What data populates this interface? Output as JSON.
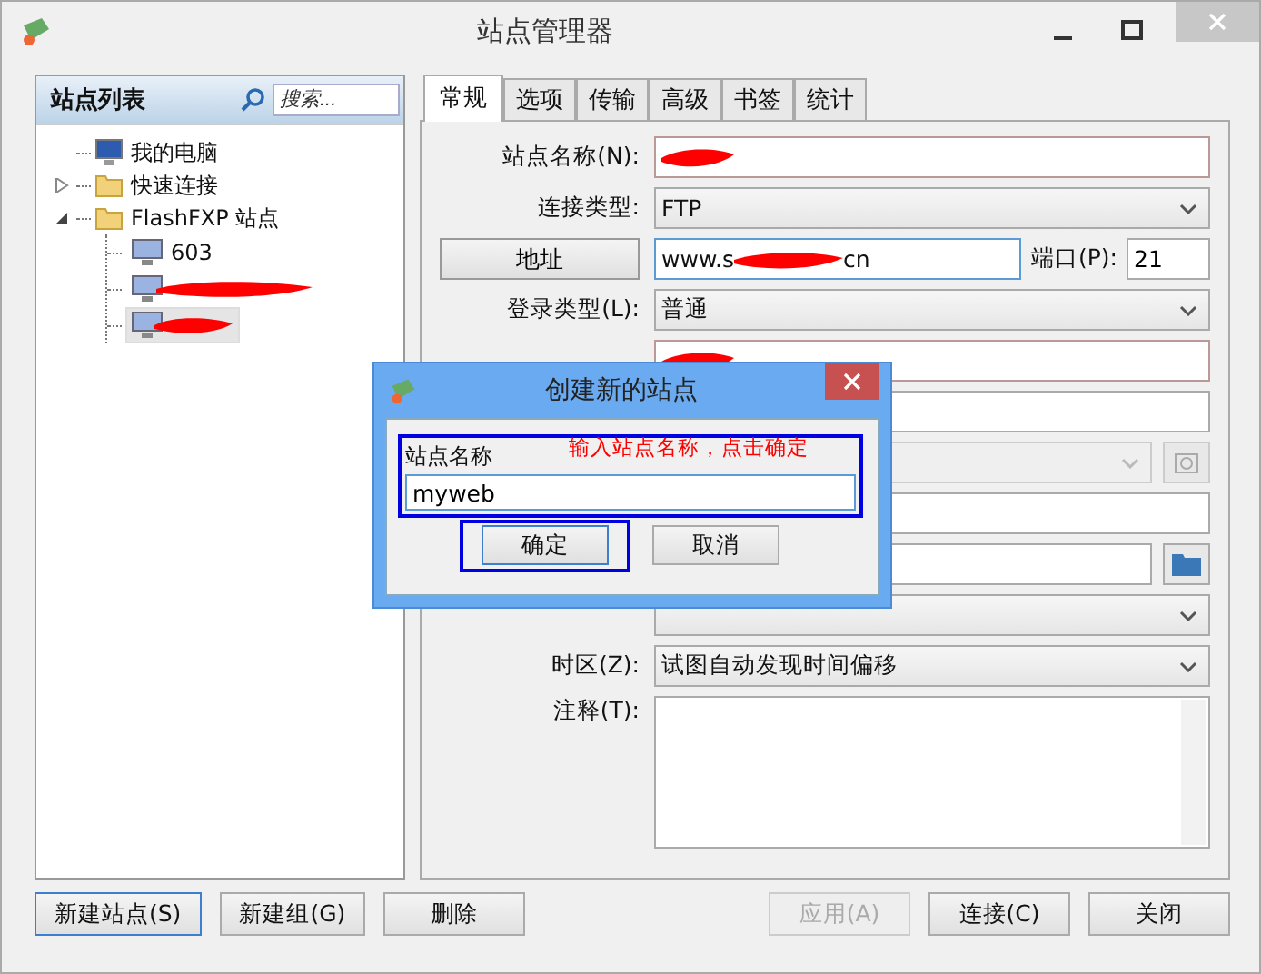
{
  "window": {
    "title": "站点管理器"
  },
  "site_list": {
    "title": "站点列表",
    "search_placeholder": "搜索...",
    "tree": [
      {
        "label": "我的电脑",
        "kind": "computer",
        "selected": false
      },
      {
        "label": "快速连接",
        "kind": "folder",
        "expanded": false,
        "selected": false
      },
      {
        "label": "FlashFXP 站点",
        "kind": "folder",
        "expanded": true,
        "selected": false,
        "children": [
          {
            "label": "603",
            "kind": "computer",
            "redacted": false,
            "selected": false
          },
          {
            "kind": "computer",
            "redacted": true,
            "selected": false
          },
          {
            "kind": "computer",
            "redacted": true,
            "selected": true
          }
        ]
      }
    ]
  },
  "tabs": [
    {
      "label": "常规",
      "selected": true
    },
    {
      "label": "选项",
      "selected": false
    },
    {
      "label": "传输",
      "selected": false
    },
    {
      "label": "高级",
      "selected": false
    },
    {
      "label": "书签",
      "selected": false
    },
    {
      "label": "统计",
      "selected": false
    }
  ],
  "form": [
    {
      "kind": "text",
      "label": "站点名称(N):",
      "redacted": true
    },
    {
      "kind": "combo",
      "label": "连接类型:",
      "value": "FTP",
      "disabled": false
    },
    {
      "kind": "address",
      "button": "地址",
      "value_start": "www.s",
      "value_end": "cn",
      "redacted": true,
      "port_label": "端口(P):",
      "port": "21"
    },
    {
      "kind": "combo",
      "label": "登录类型(L):",
      "value": "普通",
      "disabled": false
    },
    {
      "kind": "text",
      "redacted": true
    },
    {
      "kind": "text"
    },
    {
      "kind": "combo_button",
      "disabled": true
    },
    {
      "kind": "text"
    },
    {
      "kind": "path"
    },
    {
      "kind": "combo",
      "disabled": false
    },
    {
      "kind": "combo",
      "label": "时区(Z):",
      "value": "试图自动发现时间偏移",
      "disabled": false
    },
    {
      "kind": "textarea",
      "label": "注释(T):"
    }
  ],
  "buttons": [
    {
      "label": "新建站点(S)",
      "focused": true,
      "disabled": false
    },
    {
      "label": "新建组(G)",
      "focused": false,
      "disabled": false
    },
    {
      "label": "删除",
      "focused": false,
      "disabled": false
    },
    {
      "label": "应用(A)",
      "focused": false,
      "disabled": true
    },
    {
      "label": "连接(C)",
      "focused": false,
      "disabled": false
    },
    {
      "label": "关闭",
      "focused": false,
      "disabled": false
    }
  ],
  "dialog": {
    "title": "创建新的站点",
    "field_label": "站点名称",
    "note": "输入站点名称，点击确定",
    "value": "myweb",
    "field_highlighted": true,
    "buttons": [
      {
        "label": "确定",
        "focused": true,
        "highlighted": true
      },
      {
        "label": "取消",
        "focused": false,
        "highlighted": false
      }
    ]
  }
}
